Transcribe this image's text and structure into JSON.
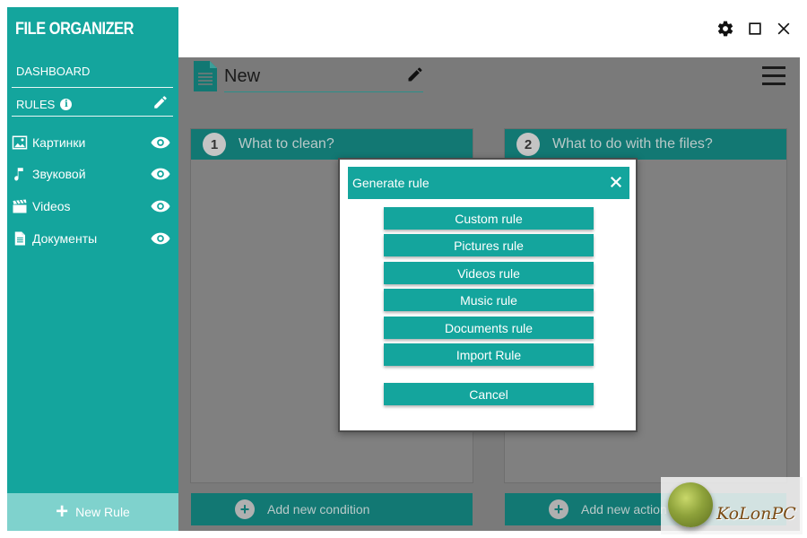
{
  "app": {
    "title": "FILE ORGANIZER"
  },
  "sidebar": {
    "dashboard_label": "DASHBOARD",
    "rules_label": "RULES",
    "info_glyph": "i",
    "items": [
      {
        "label": "Картинки",
        "icon": "image-icon"
      },
      {
        "label": "Звуковой",
        "icon": "music-note-icon"
      },
      {
        "label": "Videos",
        "icon": "clapperboard-icon"
      },
      {
        "label": "Документы",
        "icon": "document-icon"
      }
    ],
    "new_rule_label": "New Rule",
    "new_rule_glyph": "+"
  },
  "header": {
    "rule_name": "New"
  },
  "panels": {
    "conditions": {
      "step": "1",
      "title": "What to clean?",
      "add_label": "Add new condition"
    },
    "actions": {
      "step": "2",
      "title": "What to do with the files?",
      "add_label": "Add new action"
    }
  },
  "dialog": {
    "title": "Generate rule",
    "buttons": [
      "Custom rule",
      "Pictures rule",
      "Videos rule",
      "Music rule",
      "Documents rule",
      "Import Rule"
    ],
    "cancel_label": "Cancel"
  },
  "watermark": {
    "text": "KoLonPC"
  },
  "colors": {
    "accent": "#14a59d",
    "accent_dark": "#127873",
    "sidebar_new_rule": "#7fd2cd",
    "overlay_gray": "#7a7a7a"
  }
}
